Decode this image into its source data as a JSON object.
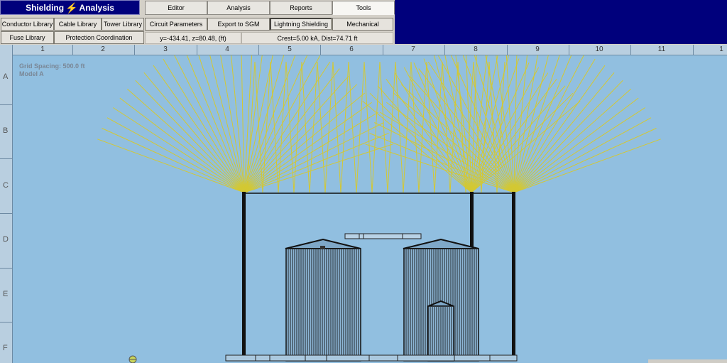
{
  "app": {
    "title_part1": "Shielding",
    "title_part2": "Analysis"
  },
  "tabs": [
    {
      "label": "Editor"
    },
    {
      "label": "Analysis"
    },
    {
      "label": "Reports"
    },
    {
      "label": "Tools"
    }
  ],
  "toolbar_row1": {
    "conductor_library": "Conductor Library",
    "cable_library": "Cable Library",
    "tower_library": "Tower Library",
    "circuit_parameters": "Circuit Parameters",
    "export_sgm": "Export to SGM",
    "lightning_shielding": "Lightning Shielding",
    "mechanical": "Mechanical"
  },
  "toolbar_row2": {
    "fuse_library": "Fuse Library",
    "protection_coordination": "Protection Coordination",
    "coords_readout": "y=-434.41, z=80.48, (ft)",
    "crest_readout": "Crest=5.00 kA, Dist=74.71 ft"
  },
  "canvas": {
    "grid_spacing": "Grid Spacing: 500.0 ft",
    "model": "Model A",
    "col_labels": [
      "1",
      "2",
      "3",
      "4",
      "5",
      "6",
      "7",
      "8",
      "9",
      "10",
      "11",
      "1"
    ],
    "row_labels": [
      "A",
      "B",
      "C",
      "D",
      "E",
      "F"
    ]
  },
  "colors": {
    "title_bg": "#00007c",
    "canvas_bg": "#91bfe0",
    "strike_rays": "#d7c92a",
    "structure": "#111111"
  }
}
